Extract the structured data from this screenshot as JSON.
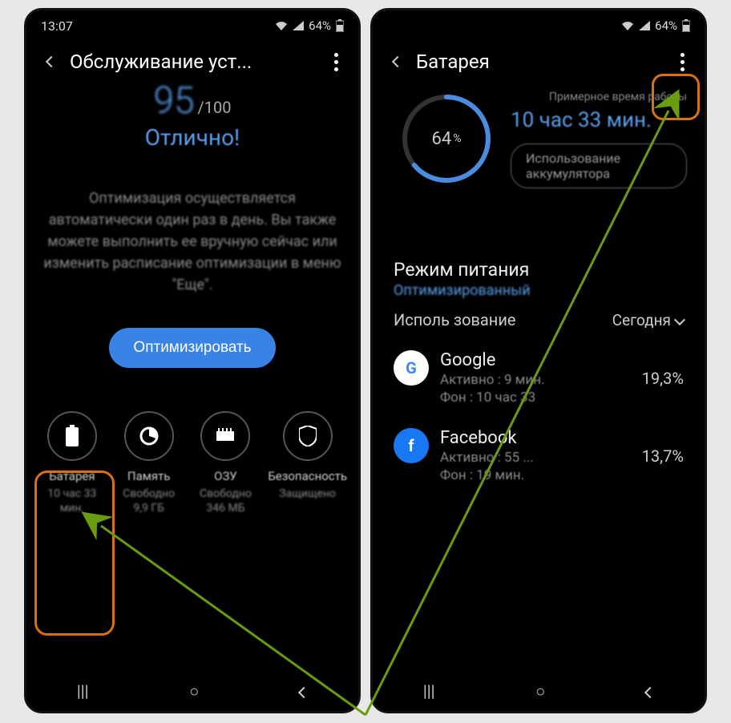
{
  "left": {
    "time": "13:07",
    "batt": "64%",
    "title": "Обслуживание уст...",
    "score": "95",
    "score_of": "/100",
    "status": "Отлично!",
    "desc": "Оптимизация осуществляется автоматически один раз в день. Вы также можете выполнить ее вручную сейчас или изменить расписание оптимизации в меню \"Еще\".",
    "optimize": "Оптимизировать",
    "tiles": [
      {
        "label": "Батарея",
        "sub": "10 час 33 мин."
      },
      {
        "label": "Память",
        "sub": "Свободно 9,9 ГБ"
      },
      {
        "label": "ОЗУ",
        "sub": "Свободно 346 МБ"
      },
      {
        "label": "Безопасность",
        "sub": "Защищено"
      }
    ]
  },
  "right": {
    "batt_pct": "64",
    "title": "Батарея",
    "approx": "Примерное время работы",
    "remaining": "10 час 33 мин.",
    "usage_btn": "Использование аккумулятора",
    "section": "Режим питания",
    "mode": "Оптимизированный",
    "usage_label": "Исполь зование",
    "usage_val": "Сегодня",
    "apps": [
      {
        "name": "Google",
        "active": "Активно : 9 мин.",
        "bg": "Фон : 10 час 33",
        "pct": "19,3%"
      },
      {
        "name": "Facebook",
        "active": "Активно : 55 ...",
        "bg": "Фон : 19 мин.",
        "pct": "13,7%"
      }
    ]
  },
  "sig": "64%"
}
